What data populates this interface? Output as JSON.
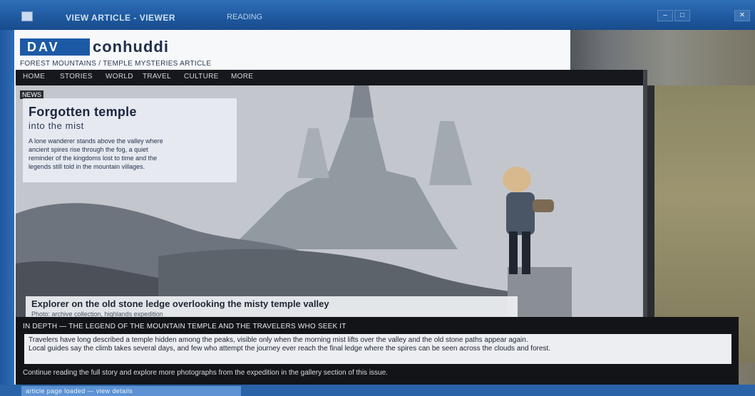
{
  "window": {
    "title": "VIEW ARTICLE - VIEWER",
    "title_extra": "READING",
    "minimize_label": "–",
    "maximize_label": "□",
    "close_label": "✕"
  },
  "header": {
    "logo_text": "DAV",
    "site_name": "conhuddi",
    "subtitle": "FOREST MOUNTAINS / TEMPLE MYSTERIES ARTICLE"
  },
  "nav": {
    "items": [
      "HOME",
      "STORIES",
      "WORLD",
      "TRAVEL",
      "CULTURE",
      "MORE"
    ]
  },
  "hero": {
    "crumb": "NEWS",
    "title": "Forgotten temple",
    "subtitle": "into the mist",
    "body": [
      "A lone wanderer stands above the valley where",
      "ancient spires rise through the fog, a quiet",
      "reminder of the kingdoms lost to time and the",
      "legends still told in the mountain villages."
    ],
    "caption_title": "Explorer on the old stone ledge overlooking the misty temple valley",
    "caption_sub": "Photo: archive collection, highlands expedition"
  },
  "article": {
    "head": "IN DEPTH  —  THE LEGEND OF THE MOUNTAIN TEMPLE AND THE TRAVELERS WHO SEEK IT",
    "lines": [
      "Travelers have long described a temple hidden among the peaks, visible only when the morning mist lifts over the valley and the old stone paths appear again.",
      "Local guides say the climb takes several days, and few who attempt the journey ever reach the final ledge where the spires can be seen across the clouds and forest."
    ],
    "foot": "Continue reading the full story and explore more photographs from the expedition in the gallery section of this issue."
  },
  "status": {
    "tab_label": "article page loaded — view details"
  }
}
